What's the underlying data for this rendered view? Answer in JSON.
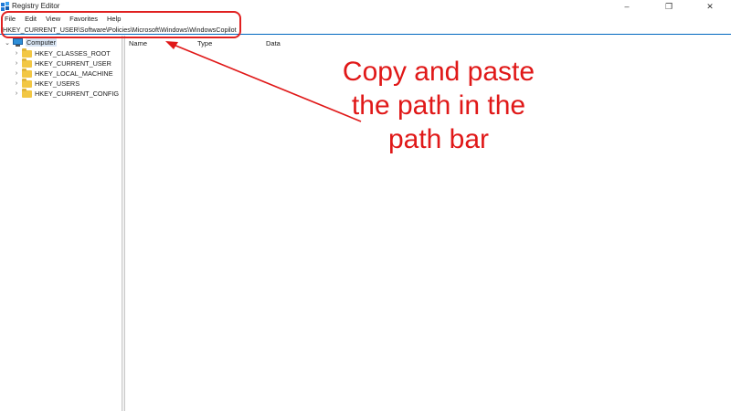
{
  "window": {
    "title": "Registry Editor",
    "controls": {
      "minimize": "–",
      "maximize": "❐",
      "close": "✕"
    }
  },
  "menu": [
    "File",
    "Edit",
    "View",
    "Favorites",
    "Help"
  ],
  "address": {
    "value": "HKEY_CURRENT_USER\\Software\\Policies\\Microsoft\\Windows\\WindowsCopilot"
  },
  "tree": {
    "root": "Computer",
    "children": [
      "HKEY_CLASSES_ROOT",
      "HKEY_CURRENT_USER",
      "HKEY_LOCAL_MACHINE",
      "HKEY_USERS",
      "HKEY_CURRENT_CONFIG"
    ]
  },
  "list": {
    "columns": [
      "Name",
      "Type",
      "Data"
    ]
  },
  "annotation": {
    "lines": [
      "Copy and paste",
      "the path in the",
      "path bar"
    ],
    "color": "#e01818"
  },
  "icons": [
    "registry-editor-app-icon",
    "computer-icon",
    "folder-icon",
    "chevron-right-icon",
    "chevron-down-icon"
  ]
}
